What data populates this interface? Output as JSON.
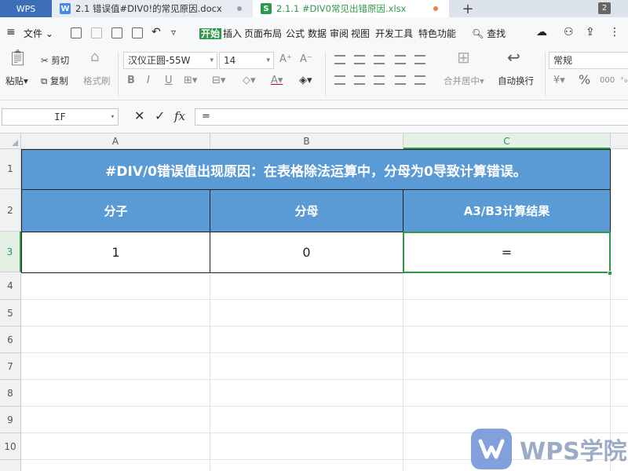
{
  "titlebar": {
    "app": "WPS",
    "tabs": [
      {
        "label": "2.1 错误值#DIV0!的常见原因.docx",
        "badge": "W",
        "badge_color": "#4a86e8"
      },
      {
        "label": "2.1.1 #DIV0常见出错原因.xlsx",
        "badge": "S",
        "badge_color": "#2e9948"
      }
    ],
    "window_count": "2"
  },
  "menu": {
    "file": "文件",
    "items": [
      "开始",
      "插入",
      "页面布局",
      "公式",
      "数据",
      "审阅",
      "视图",
      "开发工具",
      "特色功能"
    ],
    "active_index": 0,
    "search": "查找"
  },
  "ribbon": {
    "paste": "粘贴",
    "cut": "剪切",
    "copy": "复制",
    "format_painter": "格式刷",
    "font_name": "汉仪正圆-55W",
    "font_size": "14",
    "merge_center": "合并居中",
    "wrap_text": "自动换行",
    "number_format": "常规"
  },
  "formula_bar": {
    "name_box": "IF",
    "cancel": "✕",
    "confirm": "✓",
    "fx": "fx",
    "formula": "="
  },
  "sheet": {
    "columns": [
      "A",
      "B",
      "C"
    ],
    "rows": [
      "1",
      "2",
      "3",
      "4",
      "5",
      "6",
      "7",
      "8",
      "9",
      "10"
    ],
    "title": "#DIV/0错误值出现原因：在表格除法运算中，分母为0导致计算错误。",
    "headers": [
      "分子",
      "分母",
      "A3/B3计算结果"
    ],
    "values": [
      "1",
      "0",
      "="
    ],
    "selected_cell": "C3"
  },
  "watermark": {
    "text": "WPS学院"
  }
}
